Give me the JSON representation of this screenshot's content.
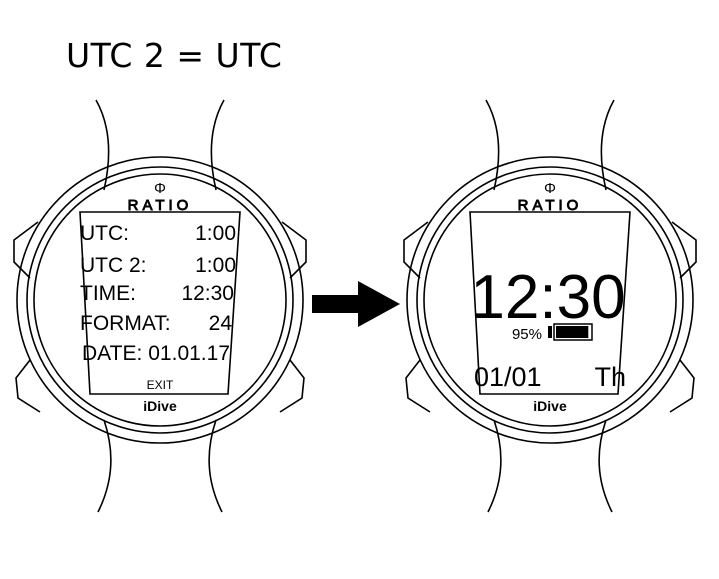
{
  "heading": "UTC 2 = UTC",
  "watch_left": {
    "brand_symbol": "Φ",
    "brand": "RATIO",
    "model": "iDive",
    "menu": [
      {
        "label": "UTC:",
        "value": "1:00"
      },
      {
        "label": "UTC 2:",
        "value": "1:00"
      },
      {
        "label": "TIME:",
        "value": "12:30"
      },
      {
        "label": "FORMAT:",
        "value": "24"
      },
      {
        "label": "DATE:",
        "value": "01.01.17"
      }
    ],
    "exit_label": "EXIT"
  },
  "watch_right": {
    "brand_symbol": "Φ",
    "brand": "RATIO",
    "model": "iDive",
    "time": "12:30",
    "battery_percent": "95%",
    "battery_level": 0.95,
    "date": "01/01",
    "weekday": "Th"
  },
  "arrow_icon": "right-arrow-icon"
}
